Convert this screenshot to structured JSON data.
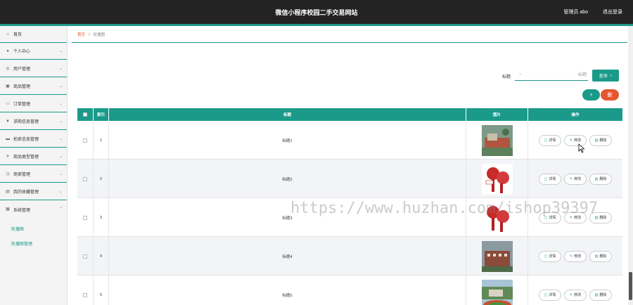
{
  "header": {
    "title": "微信小程序校园二手交易网站",
    "admin_label": "管理员 abo",
    "logout_label": "退出登录"
  },
  "sidebar": {
    "items": [
      {
        "label": "首页",
        "icon": "home-icon"
      },
      {
        "label": "个人中心",
        "icon": "user-icon"
      },
      {
        "label": "用户管理",
        "icon": "user-manage-icon"
      },
      {
        "label": "商品管理",
        "icon": "goods-icon"
      },
      {
        "label": "订单管理",
        "icon": "order-icon"
      },
      {
        "label": "求购信息管理",
        "icon": "message-icon"
      },
      {
        "label": "拍卖信息管理",
        "icon": "auction-icon"
      },
      {
        "label": "商品类型管理",
        "icon": "tag-icon"
      },
      {
        "label": "商家管理",
        "icon": "store-icon"
      },
      {
        "label": "我的收藏管理",
        "icon": "star-icon"
      },
      {
        "label": "系统管理",
        "icon": "settings-icon"
      }
    ],
    "submenu": [
      {
        "label": "轮播图"
      },
      {
        "label": "轮播图管理"
      }
    ]
  },
  "breadcrumb": {
    "home": "首页",
    "current": "轮播图"
  },
  "search": {
    "label": "标题",
    "placeholder": "标题",
    "button_label": "查询"
  },
  "toolbar": {
    "add_label": "+",
    "delete_label": "删"
  },
  "table": {
    "headers": {
      "index": "索引",
      "title": "标题",
      "image": "图片",
      "actions": "操作"
    },
    "action_labels": {
      "detail": "详情",
      "edit": "修改",
      "delete": "删除"
    },
    "rows": [
      {
        "index": "1",
        "title": "标题1"
      },
      {
        "index": "2",
        "title": "标题2"
      },
      {
        "index": "3",
        "title": "标题3"
      },
      {
        "index": "4",
        "title": "标题4"
      },
      {
        "index": "5",
        "title": "标题5"
      }
    ]
  },
  "watermark": "https://www.huzhan.com/ishop39397",
  "colors": {
    "primary": "#1b9a8a",
    "danger": "#e4572e",
    "header_bg": "#232323"
  }
}
